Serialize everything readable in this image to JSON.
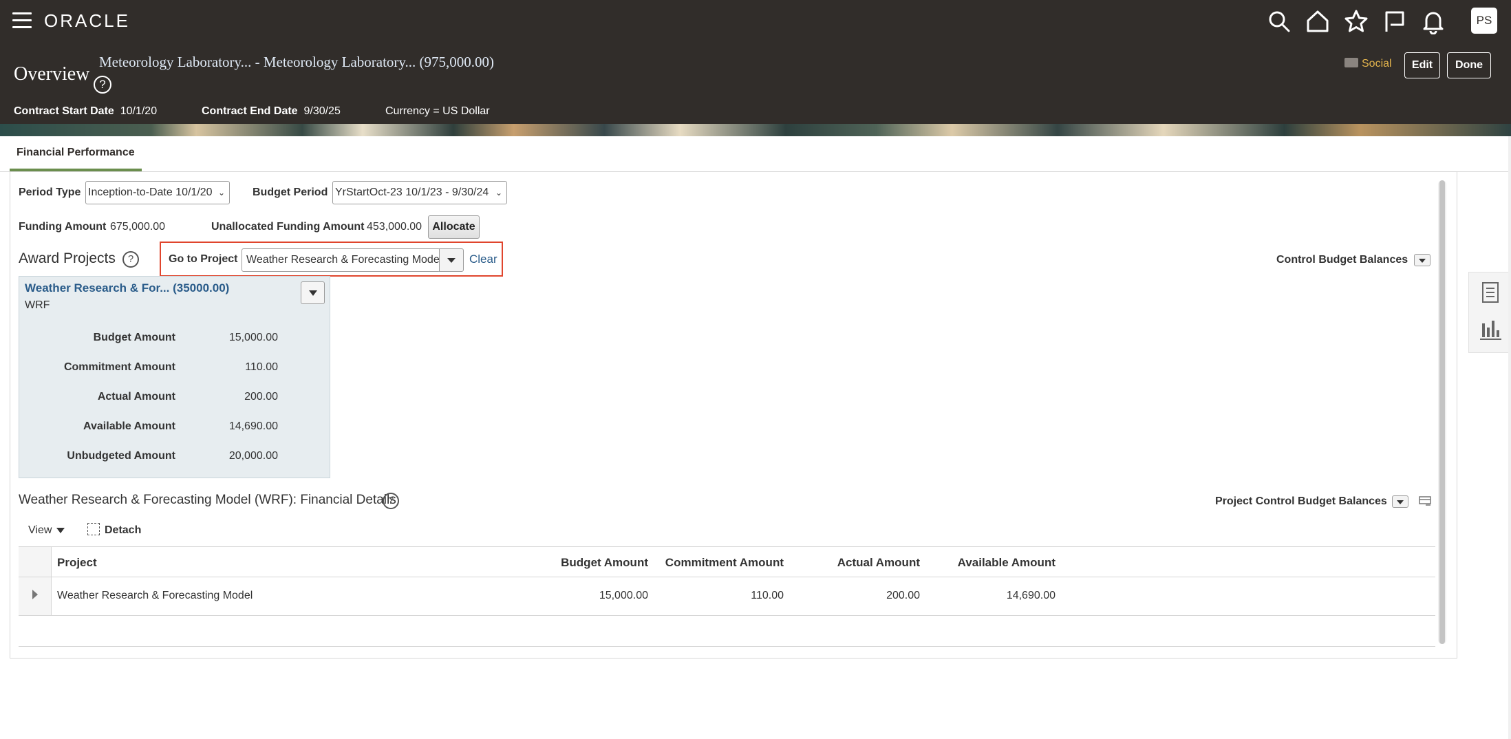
{
  "header": {
    "logo": "ORACLE",
    "avatar": "PS",
    "page_title": "Overview",
    "contract_name": "Meteorology Laboratory... - Meteorology Laboratory... (975,000.00)",
    "help_glyph": "?",
    "social_label": "Social",
    "edit_label": "Edit",
    "done_label": "Done",
    "icons": [
      "menu-icon",
      "search-icon",
      "home-icon",
      "star-icon",
      "flag-icon",
      "bell-icon"
    ],
    "contract_start_label": "Contract Start Date",
    "contract_start_value": "10/1/20",
    "contract_end_label": "Contract End Date",
    "contract_end_value": "9/30/25",
    "currency": "Currency = US Dollar"
  },
  "tabs": [
    {
      "label": "Financial Performance",
      "active": true
    }
  ],
  "filters": {
    "period_type_label": "Period Type",
    "period_type_value": "Inception-to-Date 10/1/20",
    "budget_period_label": "Budget Period",
    "budget_period_value": "YrStartOct-23 10/1/23 - 9/30/24",
    "funding_amount_label": "Funding Amount",
    "funding_amount_value": "675,000.00",
    "unallocated_label": "Unallocated Funding Amount",
    "unallocated_value": "453,000.00",
    "allocate_label": "Allocate"
  },
  "award_projects": {
    "title": "Award Projects",
    "goto_label": "Go to Project",
    "goto_value": "Weather Research & Forecasting Model",
    "clear_label": "Clear",
    "control_budget_label": "Control Budget Balances",
    "card": {
      "title": "Weather Research & For... (35000.00)",
      "code": "WRF",
      "rows": [
        {
          "label": "Budget Amount",
          "value": "15,000.00"
        },
        {
          "label": "Commitment Amount",
          "value": "110.00"
        },
        {
          "label": "Actual Amount",
          "value": "200.00"
        },
        {
          "label": "Available Amount",
          "value": "14,690.00"
        },
        {
          "label": "Unbudgeted Amount",
          "value": "20,000.00"
        }
      ]
    }
  },
  "financial_details": {
    "title": "Weather Research & Forecasting Model (WRF): Financial Details",
    "project_control_label": "Project Control Budget Balances",
    "view_label": "View",
    "detach_label": "Detach",
    "columns": [
      "Project",
      "Budget Amount",
      "Commitment Amount",
      "Actual Amount",
      "Available Amount"
    ],
    "rows": [
      {
        "project": "Weather Research & Forecasting Model",
        "budget": "15,000.00",
        "commitment": "110.00",
        "actual": "200.00",
        "available": "14,690.00"
      }
    ]
  },
  "colors": {
    "header_bg": "#312d2a",
    "link": "#2a5c8a",
    "highlight_border": "#e0452d",
    "tab_underline": "#6b8e4e",
    "card_bg": "#e7edf0",
    "social": "#e3b44d"
  }
}
